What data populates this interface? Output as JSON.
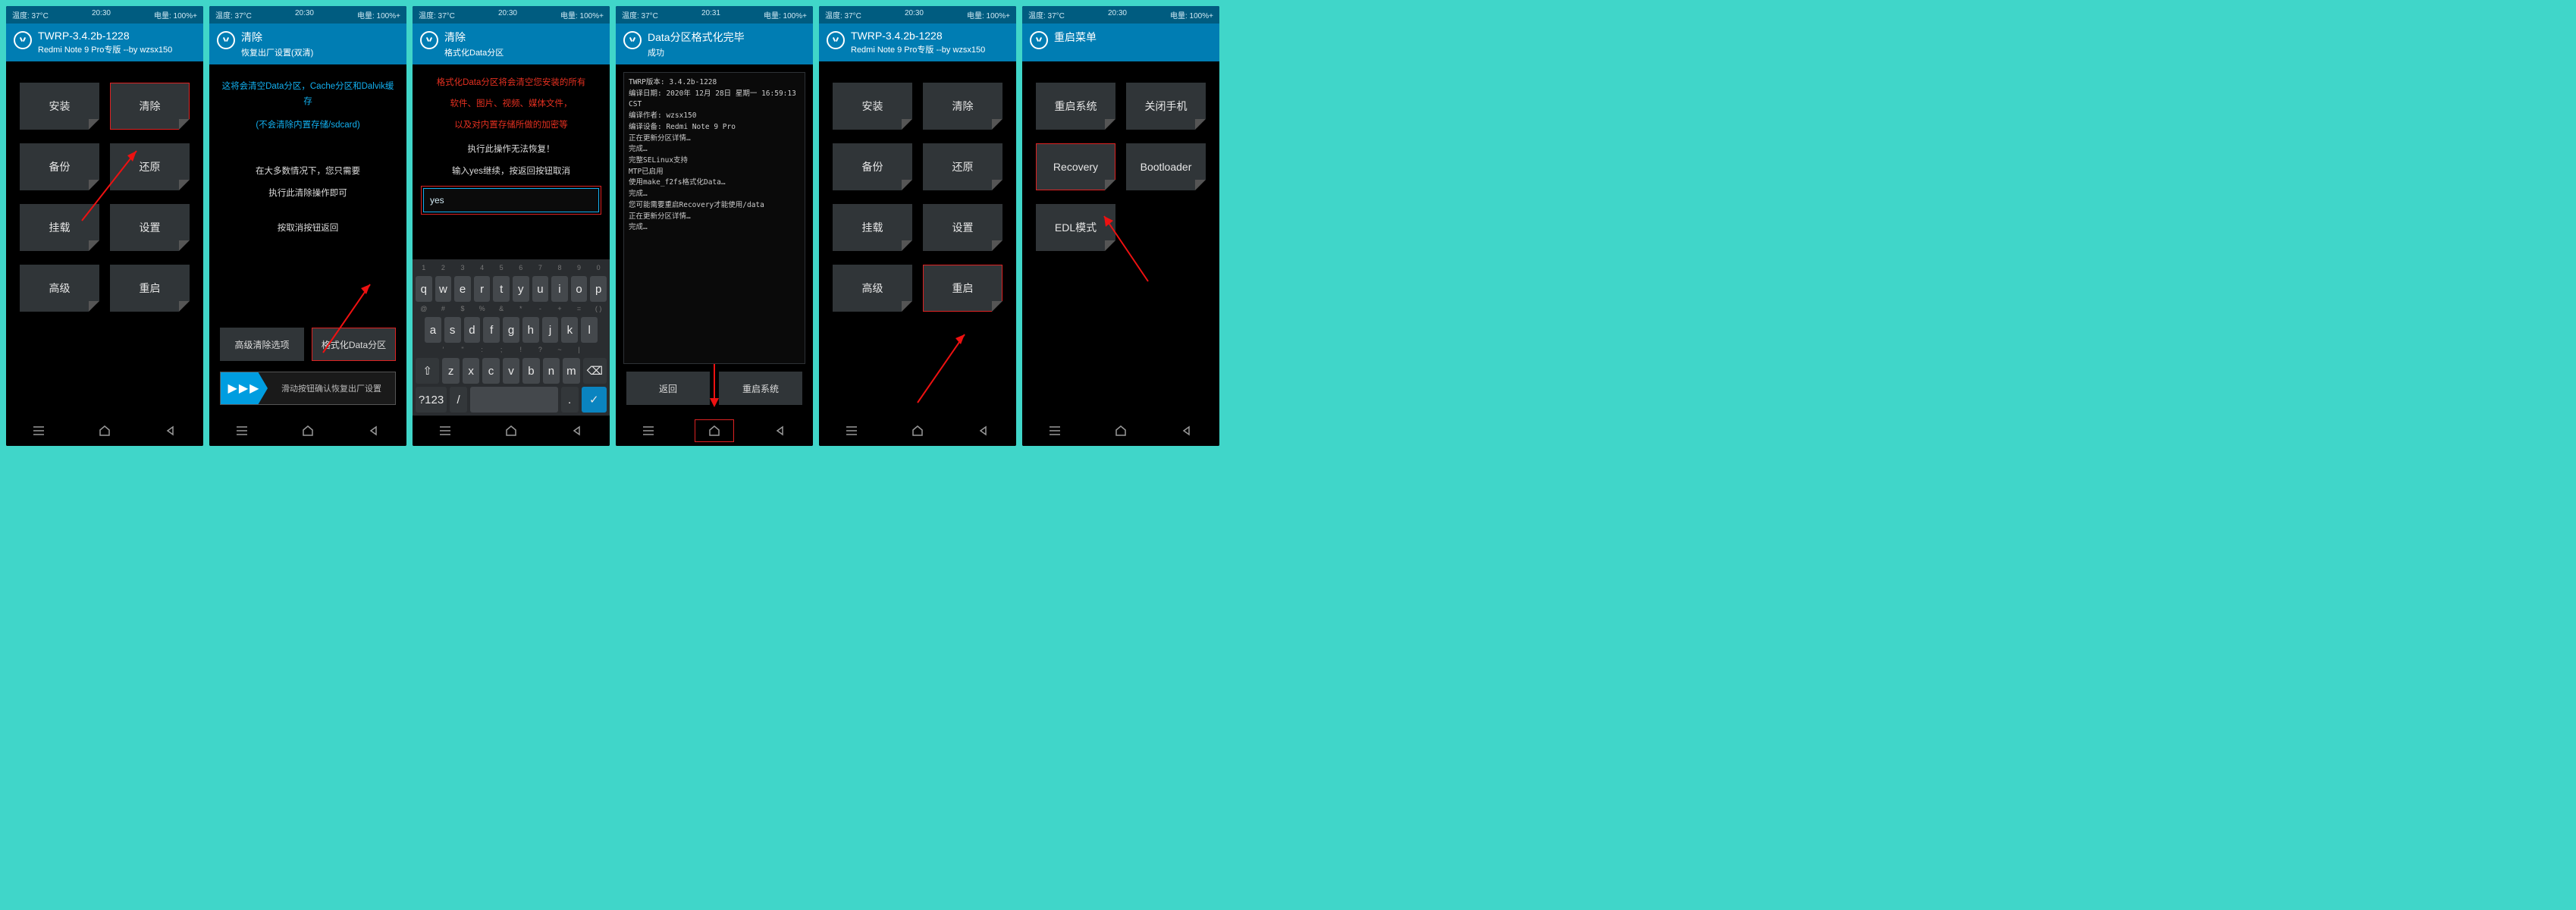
{
  "status": {
    "temp": "温度: 37°C",
    "time": "20:30",
    "time_alt": "20:31",
    "batt": "电量: 100%+"
  },
  "twrp_header": {
    "title": "TWRP-3.4.2b-1228",
    "subtitle": "Redmi Note 9 Pro专版  --by wzsx150"
  },
  "main_tiles": [
    "安装",
    "清除",
    "备份",
    "还原",
    "挂载",
    "设置",
    "高级",
    "重启"
  ],
  "wipe": {
    "title": "清除",
    "subtitle": "恢复出厂设置(双清)",
    "info1": "这将会清空Data分区，Cache分区和Dalvik缓存",
    "info2": "(不会清除内置存储/sdcard)",
    "info3": "在大多数情况下，您只需要",
    "info4": "执行此清除操作即可",
    "info5": "按取消按钮返回",
    "btn_adv": "高级清除选项",
    "btn_fmt": "格式化Data分区",
    "slider": "滑动按钮确认恢复出厂设置"
  },
  "format": {
    "title": "清除",
    "subtitle": "格式化Data分区",
    "warn1": "格式化Data分区将会清空您安装的所有",
    "warn2": "软件、图片、视频、媒体文件，",
    "warn3": "以及对内置存储所做的加密等",
    "line1": "执行此操作无法恢复！",
    "line2": "输入yes继续，按返回按钮取消",
    "input_value": "yes"
  },
  "keyboard": {
    "row_hints1": [
      "1",
      "2",
      "3",
      "4",
      "5",
      "6",
      "7",
      "8",
      "9",
      "0"
    ],
    "row1": [
      "q",
      "w",
      "e",
      "r",
      "t",
      "y",
      "u",
      "i",
      "o",
      "p"
    ],
    "row_hints2": [
      "@",
      "#",
      "$",
      "%",
      "&",
      "*",
      "-",
      "+",
      "=",
      "( )"
    ],
    "row2": [
      "a",
      "s",
      "d",
      "f",
      "g",
      "h",
      "j",
      "k",
      "l"
    ],
    "row_hints3": [
      "",
      "′",
      "\"",
      ":",
      ";",
      "!",
      "?",
      "~",
      "|",
      ""
    ],
    "row3": [
      "⇧",
      "z",
      "x",
      "c",
      "v",
      "b",
      "n",
      "m",
      "⌫"
    ],
    "row4": [
      "?123",
      "/",
      " ",
      ".",
      "✓"
    ]
  },
  "done": {
    "title": "Data分区格式化完毕",
    "subtitle": "成功",
    "log": "TWRP版本:   3.4.2b-1228\n编译日期:   2020年 12月 28日 星期一 16:59:13 CST\n编译作者:   wzsx150\n编译设备:   Redmi Note 9 Pro\n正在更新分区详情…\n完成…\n完整SELinux支持\nMTP已启用\n使用make_f2fs格式化Data…\n完成…\n您可能需要重启Recovery才能使用/data\n正在更新分区详情…\n完成…",
    "btn_back": "返回",
    "btn_reboot": "重启系统"
  },
  "reboot": {
    "title": "重启菜单",
    "items": [
      "重启系统",
      "关闭手机",
      "Recovery",
      "Bootloader",
      "EDL模式"
    ]
  }
}
